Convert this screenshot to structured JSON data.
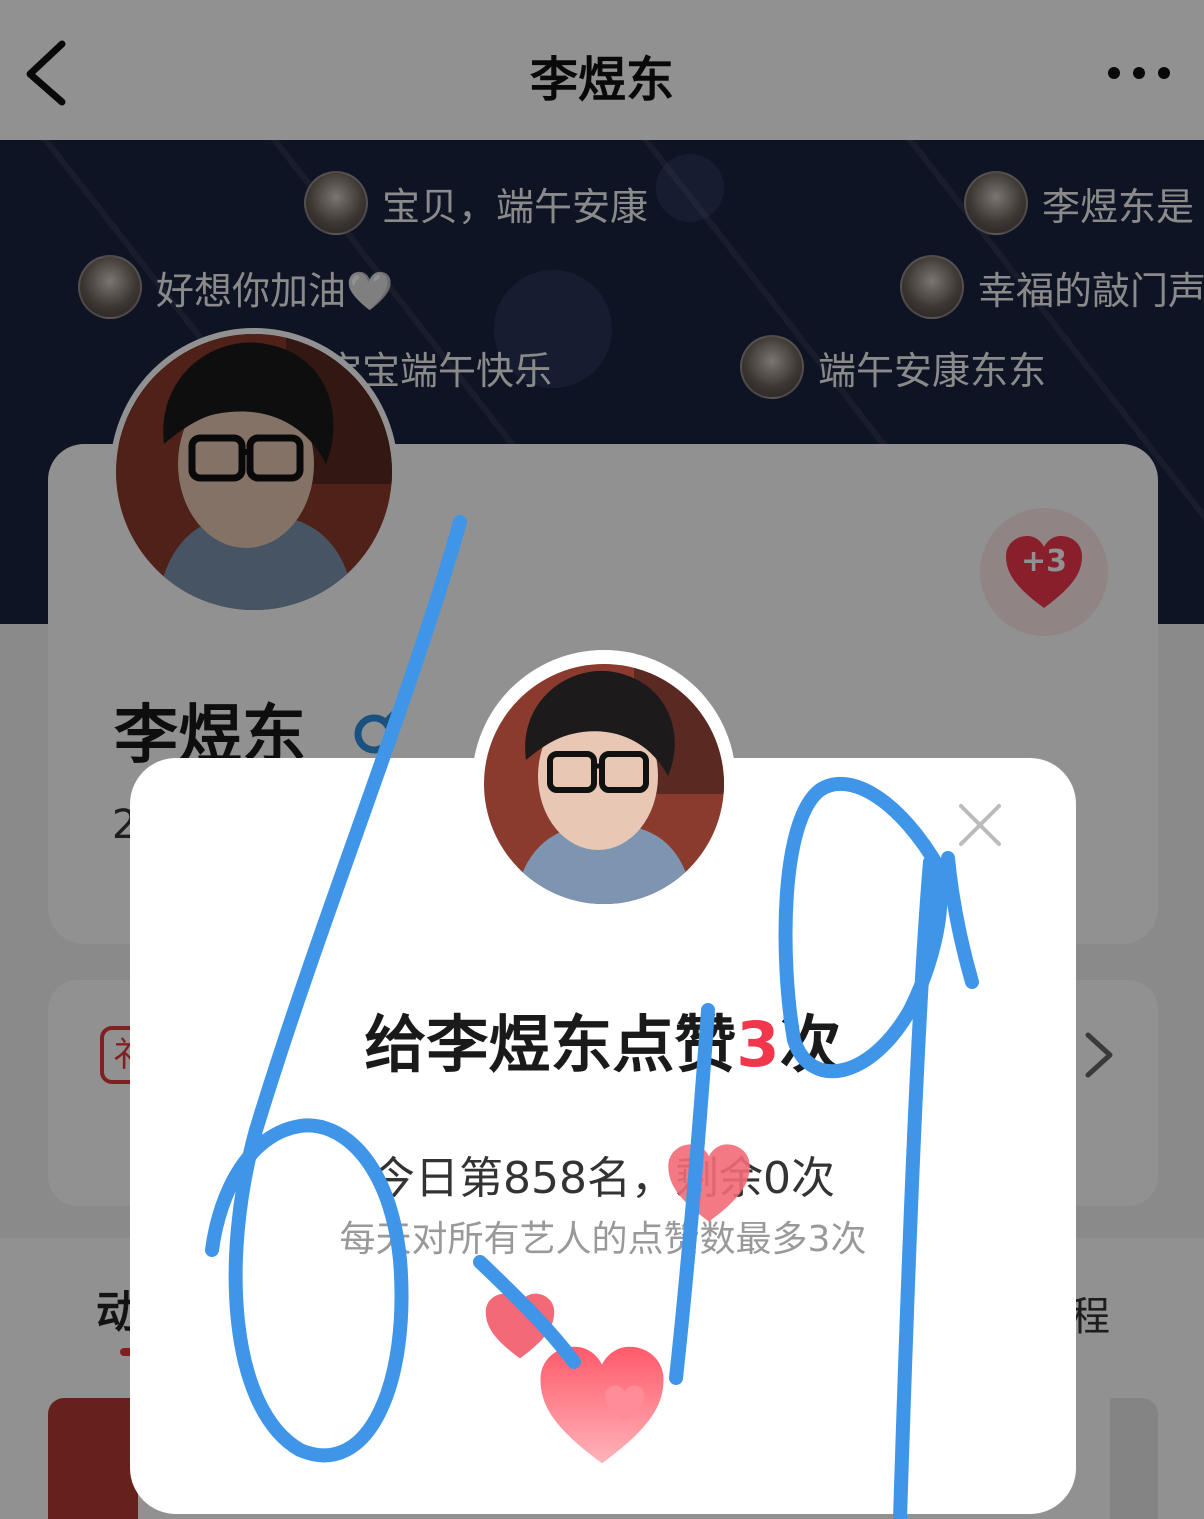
{
  "nav": {
    "title": "李煜东",
    "back_icon": "chevron-left-icon",
    "more_icon": "more-dots-icon"
  },
  "banner": {
    "danmu": [
      {
        "text": "宝贝，端午安康"
      },
      {
        "text": "李煜东是"
      },
      {
        "text": "好想你加油🤍"
      },
      {
        "text": "幸福的敲门声"
      },
      {
        "text": "宝宝端午快乐"
      },
      {
        "text": "端午安康东东"
      }
    ]
  },
  "profile": {
    "name": "李煜东",
    "gender_icon": "male-icon",
    "stat_partial": "2",
    "like_badge": "+3"
  },
  "row": {
    "tag": "礻"
  },
  "tabs": {
    "left": "动",
    "right": "程"
  },
  "modal": {
    "title_prefix": "给李煜东点赞",
    "title_count": "3",
    "title_suffix": "次",
    "rank_text": "今日第858名，剩余0次",
    "rule_text": "每天对所有艺人的点赞数最多3次",
    "close_icon": "close-icon"
  },
  "overlay": {
    "handwriting": "6.19",
    "stroke_color": "#3f96e8"
  },
  "colors": {
    "accent": "#f0374c",
    "banner": "#1c2440",
    "stroke": "#3f96e8"
  }
}
